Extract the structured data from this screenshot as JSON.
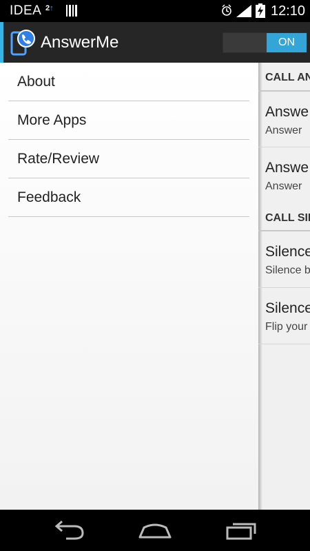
{
  "status_bar": {
    "carrier": "IDEA",
    "network_badge": "2",
    "clock": "12:10"
  },
  "action_bar": {
    "title": "AnswerMe",
    "toggle_label": "ON",
    "toggle_state": "on",
    "accent_color": "#33b5e5"
  },
  "drawer": {
    "items": [
      {
        "label": "About"
      },
      {
        "label": "More Apps"
      },
      {
        "label": "Rate/Review"
      },
      {
        "label": "Feedback"
      }
    ]
  },
  "content": {
    "sections": [
      {
        "header": "CALL AN",
        "rows": [
          {
            "title": "Answe",
            "subtitle": "Answer"
          },
          {
            "title": "Answe",
            "subtitle": "Answer"
          }
        ]
      },
      {
        "header": "CALL SIL",
        "rows": [
          {
            "title": "Silence",
            "subtitle": "Silence b"
          },
          {
            "title": "Silence",
            "subtitle": "Flip your"
          }
        ]
      }
    ]
  },
  "nav_bar": {
    "buttons": [
      "back-icon",
      "home-icon",
      "recent-apps-icon"
    ]
  }
}
